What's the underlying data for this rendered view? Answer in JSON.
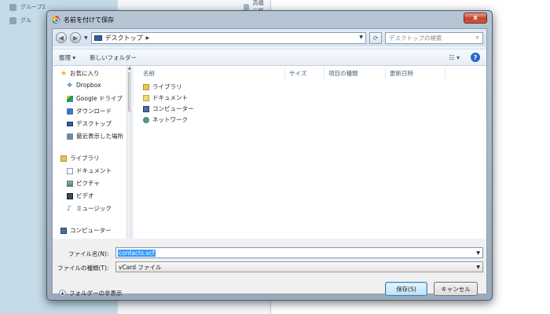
{
  "background": {
    "groups": [
      "グループ2",
      "グル"
    ],
    "contacts": [
      "高橋 三郎",
      "",
      ""
    ]
  },
  "dialog": {
    "title": "名前を付けて保存",
    "close": "x"
  },
  "address": {
    "location": "デスクトップ",
    "search_placeholder": "デスクトップの検索"
  },
  "toolbar": {
    "organize": "整理 ▾",
    "new_folder": "新しいフォルダー"
  },
  "nav": {
    "favorites": "お気に入り",
    "fav_items": [
      "Dropbox",
      "Google ドライブ",
      "ダウンロード",
      "デスクトップ",
      "最近表示した場所"
    ],
    "libraries": "ライブラリ",
    "lib_items": [
      "ドキュメント",
      "ピクチャ",
      "ビデオ",
      "ミュージック"
    ],
    "computer": "コンピューター"
  },
  "columns": {
    "name": "名前",
    "size": "サイズ",
    "type": "項目の種類",
    "date": "更新日時"
  },
  "files": [
    "ライブラリ",
    "ドキュメント",
    "コンピューター",
    "ネットワーク"
  ],
  "form": {
    "filename_label": "ファイル名(N):",
    "filename_value": "contacts.vcf",
    "filetype_label": "ファイルの種類(T):",
    "filetype_value": "vCard ファイル"
  },
  "footer": {
    "hide_folders": "フォルダーの非表示",
    "save": "保存(S)",
    "cancel": "キャンセル"
  }
}
